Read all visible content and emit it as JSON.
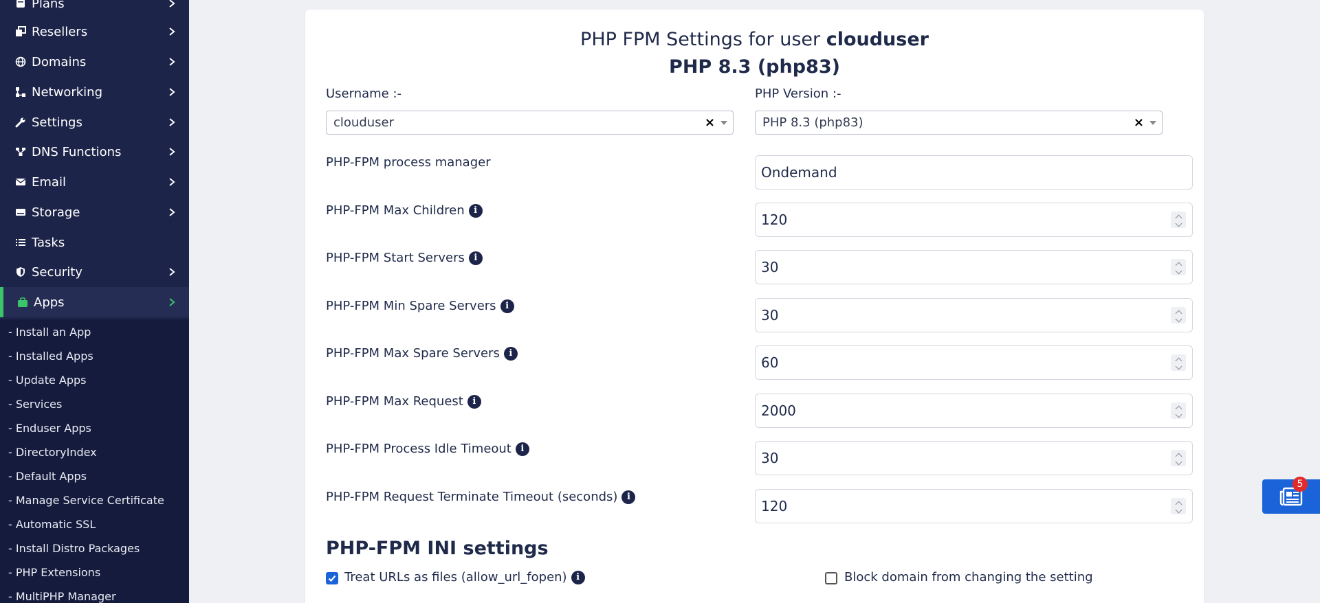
{
  "sidebar": {
    "items": [
      {
        "label": "Plans",
        "icon": "plans-icon"
      },
      {
        "label": "Resellers",
        "icon": "resellers-icon"
      },
      {
        "label": "Domains",
        "icon": "globe-icon"
      },
      {
        "label": "Networking",
        "icon": "network-icon"
      },
      {
        "label": "Settings",
        "icon": "wrench-icon"
      },
      {
        "label": "DNS Functions",
        "icon": "dns-icon"
      },
      {
        "label": "Email",
        "icon": "envelope-icon"
      },
      {
        "label": "Storage",
        "icon": "storage-icon"
      },
      {
        "label": "Tasks",
        "icon": "list-icon"
      },
      {
        "label": "Security",
        "icon": "shield-icon"
      },
      {
        "label": "Apps",
        "icon": "apps-icon"
      }
    ],
    "submenu": [
      "- Install an App",
      "- Installed Apps",
      "- Update Apps",
      "- Services",
      "- Enduser Apps",
      "- DirectoryIndex",
      "- Default Apps",
      "- Manage Service Certificate",
      "- Automatic SSL",
      "- Install Distro Packages",
      "- PHP Extensions",
      "- MultiPHP Manager"
    ]
  },
  "header": {
    "title_prefix": "PHP FPM Settings for user",
    "title_user": "clouduser",
    "subtitle": "PHP 8.3 (php83)"
  },
  "form": {
    "username_label": "Username :-",
    "username_value": "clouduser",
    "php_version_label": "PHP Version :-",
    "php_version_value": "PHP 8.3 (php83)",
    "clear_symbol": "×",
    "rows": [
      {
        "label": "PHP-FPM process manager",
        "value": "Ondemand",
        "info": false,
        "spinner": false
      },
      {
        "label": "PHP-FPM Max Children",
        "value": "120",
        "info": true,
        "spinner": true
      },
      {
        "label": "PHP-FPM Start Servers",
        "value": "30",
        "info": true,
        "spinner": true
      },
      {
        "label": "PHP-FPM Min Spare Servers",
        "value": "30",
        "info": true,
        "spinner": true
      },
      {
        "label": "PHP-FPM Max Spare Servers",
        "value": "60",
        "info": true,
        "spinner": true
      },
      {
        "label": "PHP-FPM Max Request",
        "value": "2000",
        "info": true,
        "spinner": true
      },
      {
        "label": "PHP-FPM Process Idle Timeout",
        "value": "30",
        "info": true,
        "spinner": true
      },
      {
        "label": "PHP-FPM Request Terminate Timeout (seconds)",
        "value": "120",
        "info": true,
        "spinner": true
      }
    ]
  },
  "ini": {
    "title": "PHP-FPM INI settings",
    "allow_url_fopen_label": "Treat URLs as files (allow_url_fopen)",
    "allow_url_fopen_checked": true,
    "block_label": "Block domain from changing the setting",
    "block_checked": false
  },
  "widget": {
    "badge_count": "5"
  },
  "colors": {
    "sidebar_bg": "#1d2449",
    "submenu_bg": "#151b3c",
    "active_accent": "#3cc46a",
    "primary_blue": "#1a63d8",
    "badge_red": "#e12b2b"
  }
}
